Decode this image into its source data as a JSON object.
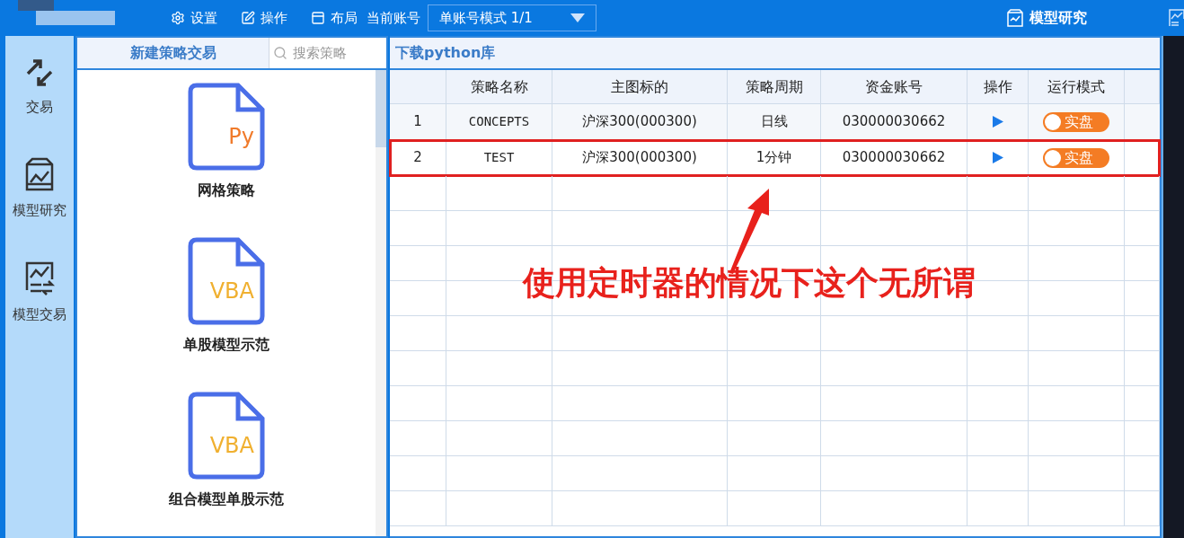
{
  "toolbar": {
    "items": [
      {
        "kind": "settings",
        "label": "设置"
      },
      {
        "kind": "edit",
        "label": "操作"
      },
      {
        "kind": "layout",
        "label": "布局"
      }
    ],
    "account_label": "当前账号",
    "account_select": {
      "value": "单账号模式 1/1"
    },
    "right_tab": {
      "label": "模型研究"
    }
  },
  "sidebar": {
    "items": [
      {
        "kind": "trade",
        "label": "交易"
      },
      {
        "kind": "research",
        "label": "模型研究"
      },
      {
        "kind": "model_trade",
        "label": "模型交易"
      }
    ]
  },
  "strategy_panel": {
    "new_button": "新建策略交易",
    "search": {
      "placeholder": "搜索策略"
    },
    "templates": [
      {
        "badge": "Py",
        "kind": "python",
        "label": "网格策略"
      },
      {
        "badge": "VBA",
        "kind": "vba",
        "label": "单股模型示范"
      },
      {
        "badge": "VBA",
        "kind": "vba",
        "label": "组合模型单股示范"
      }
    ]
  },
  "table_panel": {
    "download_link": "下载python库",
    "columns": [
      "策略名称",
      "主图标的",
      "策略周期",
      "资金账号",
      "操作",
      "运行模式"
    ],
    "rows": [
      {
        "index": "1",
        "name": "CONCEPTS",
        "target": "沪深300(000300)",
        "period": "日线",
        "account": "030000030662",
        "mode": {
          "label": "实盘",
          "on": true
        },
        "highlighted": false
      },
      {
        "index": "2",
        "name": "TEST",
        "target": "沪深300(000300)",
        "period": "1分钟",
        "account": "030000030662",
        "mode": {
          "label": "实盘",
          "on": true
        },
        "highlighted": true
      }
    ]
  },
  "annotation": "使用定时器的情况下这个无所谓"
}
